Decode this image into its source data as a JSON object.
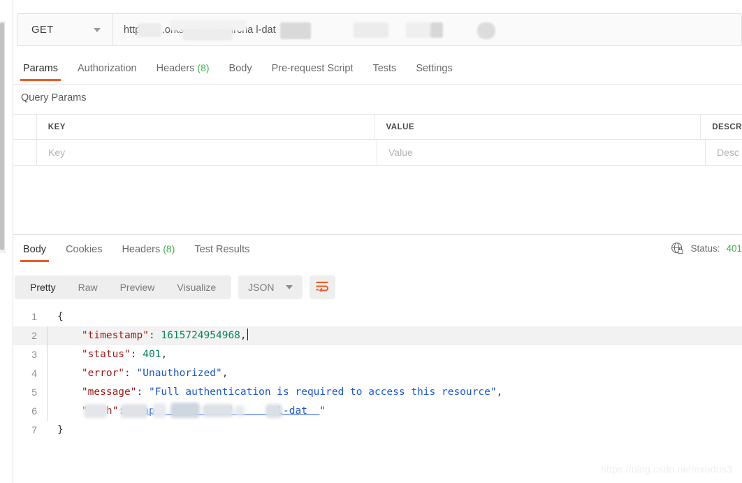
{
  "request": {
    "method": "GET",
    "url_text": "https://s            .orkshop.co       i/purcha              l-dat",
    "url_segments": [
      "https://s",
      "workshop.co",
      "i/purcha",
      "l-dat"
    ],
    "tabs": [
      {
        "label": "Params",
        "count": null,
        "active": true
      },
      {
        "label": "Authorization",
        "count": null,
        "active": false
      },
      {
        "label": "Headers",
        "count": "(8)",
        "active": false
      },
      {
        "label": "Body",
        "count": null,
        "active": false
      },
      {
        "label": "Pre-request Script",
        "count": null,
        "active": false
      },
      {
        "label": "Tests",
        "count": null,
        "active": false
      },
      {
        "label": "Settings",
        "count": null,
        "active": false
      }
    ]
  },
  "query_params": {
    "title": "Query Params",
    "headers": [
      "KEY",
      "VALUE",
      "DESCR"
    ],
    "placeholders": [
      "Key",
      "Value",
      "Desc"
    ]
  },
  "response": {
    "tabs": [
      {
        "label": "Body",
        "count": null,
        "active": true
      },
      {
        "label": "Cookies",
        "count": null,
        "active": false
      },
      {
        "label": "Headers",
        "count": "(8)",
        "active": false
      },
      {
        "label": "Test Results",
        "count": null,
        "active": false
      }
    ],
    "status_label": "Status:",
    "status_value": "401",
    "format_buttons": [
      {
        "label": "Pretty",
        "active": true
      },
      {
        "label": "Raw",
        "active": false
      },
      {
        "label": "Preview",
        "active": false
      },
      {
        "label": "Visualize",
        "active": false
      }
    ],
    "content_type": "JSON",
    "body_lines": [
      {
        "n": "1",
        "highlight": false,
        "parts": [
          {
            "t": "{",
            "c": "pun"
          }
        ]
      },
      {
        "n": "2",
        "highlight": true,
        "parts": [
          {
            "t": "    ",
            "c": "pun"
          },
          {
            "t": "\"timestamp\"",
            "c": "k"
          },
          {
            "t": ": ",
            "c": "pun"
          },
          {
            "t": "1615724954968",
            "c": "num"
          },
          {
            "t": ",",
            "c": "pun"
          }
        ],
        "cursor": true
      },
      {
        "n": "3",
        "highlight": false,
        "parts": [
          {
            "t": "    ",
            "c": "pun"
          },
          {
            "t": "\"status\"",
            "c": "k"
          },
          {
            "t": ": ",
            "c": "pun"
          },
          {
            "t": "401",
            "c": "num"
          },
          {
            "t": ",",
            "c": "pun"
          }
        ]
      },
      {
        "n": "4",
        "highlight": false,
        "parts": [
          {
            "t": "    ",
            "c": "pun"
          },
          {
            "t": "\"error\"",
            "c": "k"
          },
          {
            "t": ": ",
            "c": "pun"
          },
          {
            "t": "\"Unauthorized\"",
            "c": "str"
          },
          {
            "t": ",",
            "c": "pun"
          }
        ]
      },
      {
        "n": "5",
        "highlight": false,
        "parts": [
          {
            "t": "    ",
            "c": "pun"
          },
          {
            "t": "\"message\"",
            "c": "k"
          },
          {
            "t": ": ",
            "c": "pun"
          },
          {
            "t": "\"Full authentication is required to access this resource\"",
            "c": "str"
          },
          {
            "t": ",",
            "c": "pun"
          }
        ]
      },
      {
        "n": "6",
        "highlight": false,
        "parts": [
          {
            "t": "    ",
            "c": "pun"
          },
          {
            "t": "\"path\"",
            "c": "k"
          },
          {
            "t": ": ",
            "c": "pun"
          },
          {
            "t": "\"",
            "c": "str"
          },
          {
            "t": "/api  rcha     '       l-dat  ",
            "c": "link-str"
          },
          {
            "t": "\"",
            "c": "str"
          }
        ],
        "redacted": true
      },
      {
        "n": "7",
        "highlight": false,
        "parts": [
          {
            "t": "}",
            "c": "pun"
          }
        ]
      }
    ]
  },
  "watermark": "https://blog.csdn.net/exodus3",
  "colors": {
    "accent": "#ef5b25",
    "success": "#3bb54a",
    "key": "#a31515",
    "number": "#098658",
    "string": "#1a56d6"
  }
}
